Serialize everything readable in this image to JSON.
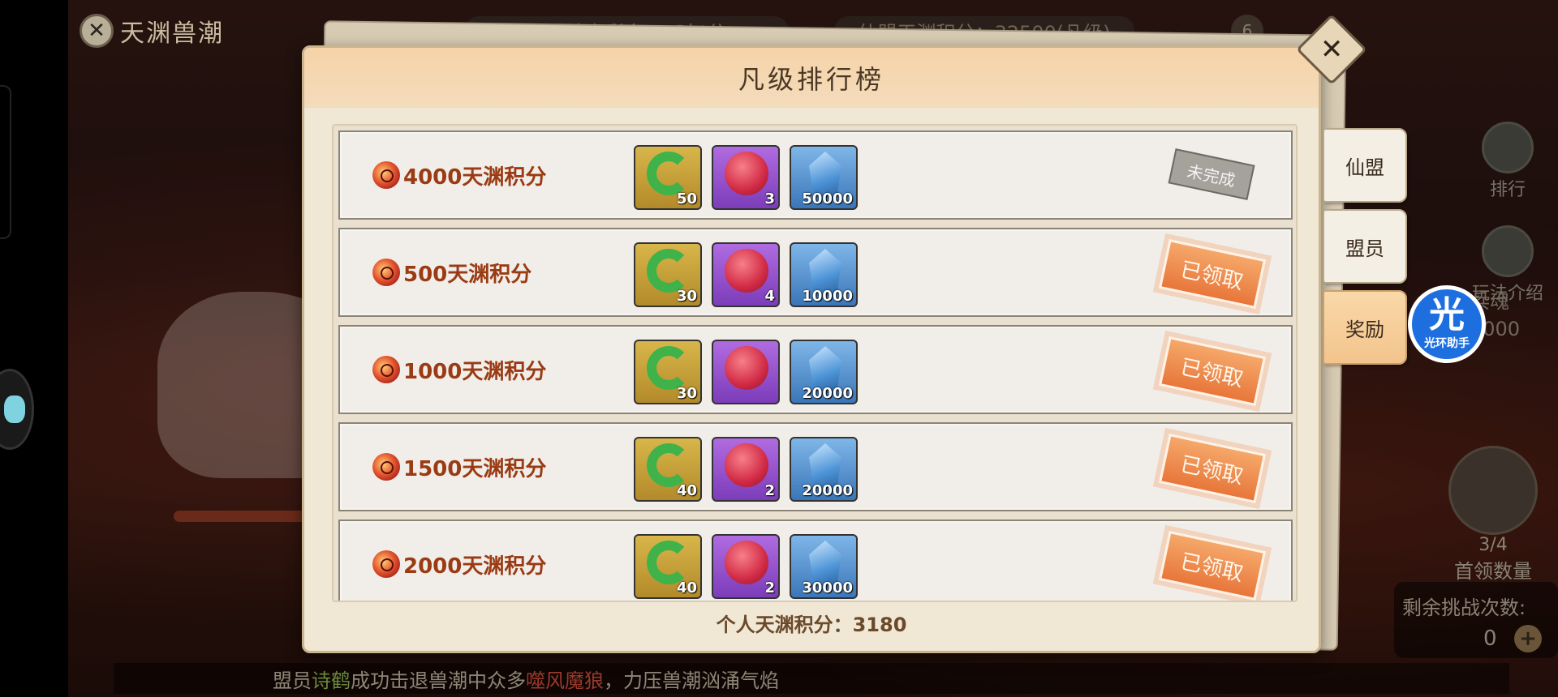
{
  "colors": {
    "accent_score": "#9a3b14",
    "claimed_stamp": "#e8763a",
    "pending_stamp": "#a5a29c",
    "modal_bg": "#f0e7d5",
    "assistant_blue": "#1d6fe0"
  },
  "header": {
    "title": "天渊兽潮",
    "back_icon": "close-icon",
    "event_timer": "活动结束剩余：9时4分",
    "alliance_score": "仙盟天渊积分：32500(凡级)",
    "badge": "6"
  },
  "right_panel": {
    "ranking_label": "排行",
    "intro_label": "玩法介绍",
    "soul_label": "兵魂",
    "soul_value": "2000",
    "boss_count": "3/4",
    "boss_label": "首领数量",
    "challenge_label": "剩余挑战次数:",
    "challenge_value": "0",
    "add_label": "+"
  },
  "marquee": {
    "prefix": "盟员",
    "member": "诗鹤",
    "middle": "成功击退兽潮中众多",
    "monster": "噬风魔狼",
    "suffix": "，力压兽潮汹涌气焰"
  },
  "modal": {
    "title": "凡级排行榜",
    "close_icon": "close-icon",
    "personal_score": "个人天渊积分：3180",
    "tabs": [
      {
        "label": "仙盟",
        "active": false
      },
      {
        "label": "盟员",
        "active": false
      },
      {
        "label": "奖励",
        "active": true
      }
    ],
    "rows": [
      {
        "score": "4000天渊积分",
        "items": [
          {
            "type": "jade",
            "qty": "50"
          },
          {
            "type": "orb",
            "qty": "3"
          },
          {
            "type": "crystal",
            "qty": "50000"
          }
        ],
        "status": "未完成",
        "status_type": "pending"
      },
      {
        "score": "500天渊积分",
        "items": [
          {
            "type": "jade",
            "qty": "30"
          },
          {
            "type": "orb",
            "qty": "4"
          },
          {
            "type": "crystal",
            "qty": "10000"
          }
        ],
        "status": "已领取",
        "status_type": "claimed"
      },
      {
        "score": "1000天渊积分",
        "items": [
          {
            "type": "jade",
            "qty": "30"
          },
          {
            "type": "orb",
            "qty": ""
          },
          {
            "type": "crystal",
            "qty": "20000"
          }
        ],
        "status": "已领取",
        "status_type": "claimed"
      },
      {
        "score": "1500天渊积分",
        "items": [
          {
            "type": "jade",
            "qty": "40"
          },
          {
            "type": "orb",
            "qty": "2"
          },
          {
            "type": "crystal",
            "qty": "20000"
          }
        ],
        "status": "已领取",
        "status_type": "claimed"
      },
      {
        "score": "2000天渊积分",
        "items": [
          {
            "type": "jade",
            "qty": "40"
          },
          {
            "type": "orb",
            "qty": "2"
          },
          {
            "type": "crystal",
            "qty": "30000"
          }
        ],
        "status": "已领取",
        "status_type": "claimed"
      }
    ]
  },
  "assistant": {
    "glyph": "光",
    "label": "光环助手"
  }
}
